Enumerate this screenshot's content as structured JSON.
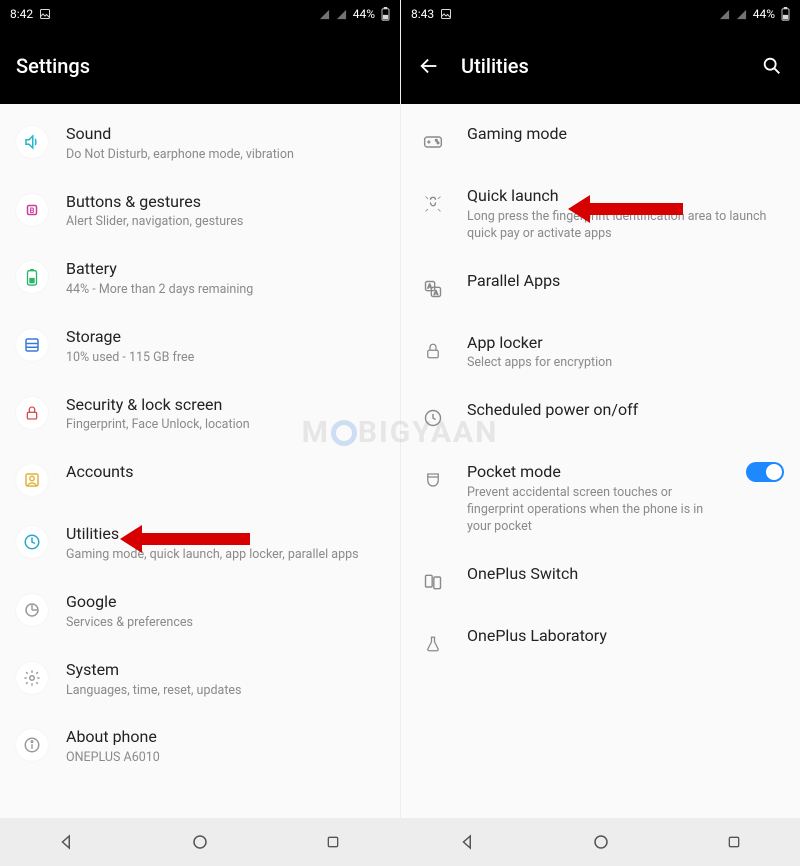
{
  "left": {
    "statusbar": {
      "time": "8:42",
      "battery_pct": "44%"
    },
    "header": {
      "title": "Settings"
    },
    "items": [
      {
        "icon": "sound",
        "label": "Sound",
        "sub": "Do Not Disturb, earphone mode, vibration"
      },
      {
        "icon": "buttons",
        "label": "Buttons & gestures",
        "sub": "Alert Slider, navigation, gestures"
      },
      {
        "icon": "battery",
        "label": "Battery",
        "sub": "44% - More than 2 days remaining"
      },
      {
        "icon": "storage",
        "label": "Storage",
        "sub": "10% used - 115 GB free"
      },
      {
        "icon": "lock",
        "label": "Security & lock screen",
        "sub": "Fingerprint, Face Unlock, location"
      },
      {
        "icon": "accounts",
        "label": "Accounts",
        "sub": ""
      },
      {
        "icon": "utilities",
        "label": "Utilities",
        "sub": "Gaming mode, quick launch, app locker, parallel apps"
      },
      {
        "icon": "google",
        "label": "Google",
        "sub": "Services & preferences"
      },
      {
        "icon": "system",
        "label": "System",
        "sub": "Languages, time, reset, updates"
      },
      {
        "icon": "about",
        "label": "About phone",
        "sub": "ONEPLUS A6010"
      }
    ]
  },
  "right": {
    "statusbar": {
      "time": "8:43",
      "battery_pct": "44%"
    },
    "header": {
      "title": "Utilities"
    },
    "items": [
      {
        "icon": "gaming",
        "label": "Gaming mode",
        "sub": ""
      },
      {
        "icon": "quicklaunch",
        "label": "Quick launch",
        "sub": "Long press the fingerprint identification area to launch quick pay or activate apps"
      },
      {
        "icon": "parallel",
        "label": "Parallel Apps",
        "sub": ""
      },
      {
        "icon": "applocker",
        "label": "App locker",
        "sub": "Select apps for encryption"
      },
      {
        "icon": "schedule",
        "label": "Scheduled power on/off",
        "sub": ""
      },
      {
        "icon": "pocket",
        "label": "Pocket mode",
        "sub": "Prevent accidental screen touches or fingerprint operations when the phone is in your pocket",
        "toggle": true
      },
      {
        "icon": "opswitch",
        "label": "OnePlus Switch",
        "sub": ""
      },
      {
        "icon": "oplab",
        "label": "OnePlus Laboratory",
        "sub": ""
      }
    ]
  },
  "watermark": "M BIGYAAN"
}
